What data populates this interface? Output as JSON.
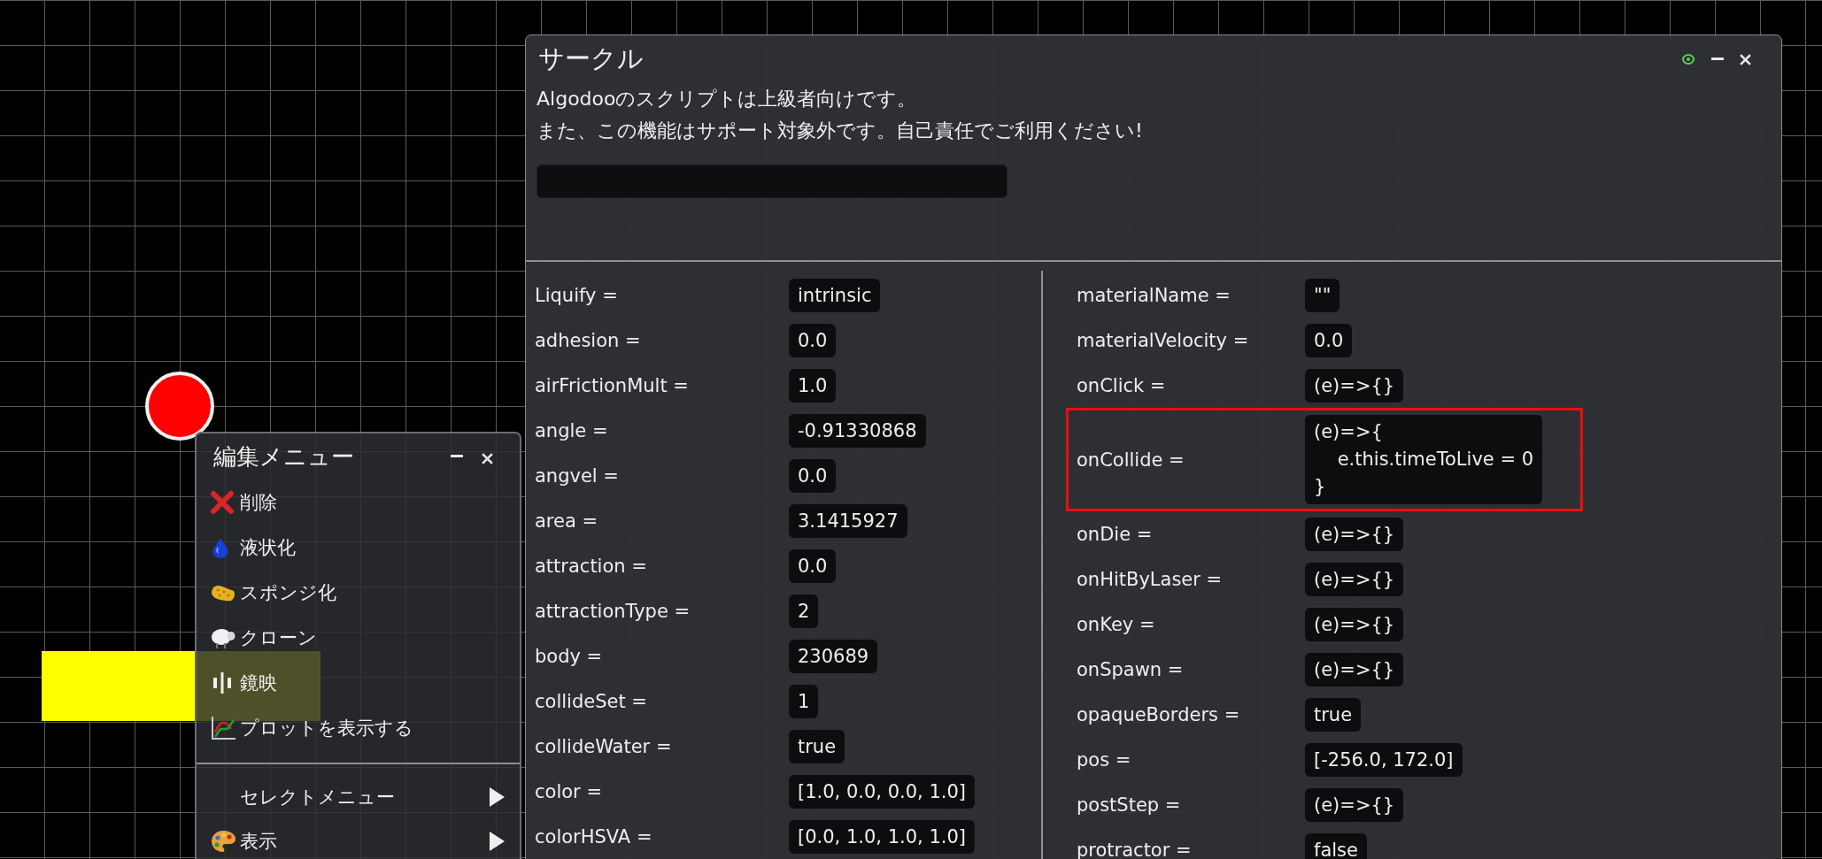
{
  "window": {
    "title": "サークル",
    "description": [
      "Algodooのスクリプトは上級者向けです。",
      "また、この機能はサポート対象外です。自己責任でご利用ください!"
    ],
    "properties": {
      "left": [
        {
          "label": "Liquify =",
          "value": "intrinsic",
          "highlighted": false
        },
        {
          "label": "adhesion =",
          "value": "0.0",
          "highlighted": false
        },
        {
          "label": "airFrictionMult =",
          "value": "1.0",
          "highlighted": false
        },
        {
          "label": "angle =",
          "value": "-0.91330868",
          "highlighted": false
        },
        {
          "label": "angvel =",
          "value": "0.0",
          "highlighted": false
        },
        {
          "label": "area =",
          "value": "3.1415927",
          "highlighted": false
        },
        {
          "label": "attraction =",
          "value": "0.0",
          "highlighted": false
        },
        {
          "label": "attractionType =",
          "value": "2",
          "highlighted": false
        },
        {
          "label": "body =",
          "value": "230689",
          "highlighted": false
        },
        {
          "label": "collideSet =",
          "value": "1",
          "highlighted": false
        },
        {
          "label": "collideWater =",
          "value": "true",
          "highlighted": false
        },
        {
          "label": "color =",
          "value": "[1.0, 0.0, 0.0, 1.0]",
          "highlighted": false
        },
        {
          "label": "colorHSVA =",
          "value": "[0.0, 1.0, 1.0, 1.0]",
          "highlighted": false
        }
      ],
      "right": [
        {
          "label": "materialName =",
          "value": "\"\"",
          "highlighted": false
        },
        {
          "label": "materialVelocity =",
          "value": "0.0",
          "highlighted": false
        },
        {
          "label": "onClick =",
          "value": "(e)=>{}",
          "highlighted": false
        },
        {
          "label": "onCollide =",
          "value": "(e)=>{\n    e.this.timeToLive = 0\n}",
          "highlighted": true
        },
        {
          "label": "onDie =",
          "value": "(e)=>{}",
          "highlighted": false
        },
        {
          "label": "onHitByLaser =",
          "value": "(e)=>{}",
          "highlighted": false
        },
        {
          "label": "onKey =",
          "value": "(e)=>{}",
          "highlighted": false
        },
        {
          "label": "onSpawn =",
          "value": "(e)=>{}",
          "highlighted": false
        },
        {
          "label": "opaqueBorders =",
          "value": "true",
          "highlighted": false
        },
        {
          "label": "pos =",
          "value": "[-256.0, 172.0]",
          "highlighted": false
        },
        {
          "label": "postStep =",
          "value": "(e)=>{}",
          "highlighted": false
        },
        {
          "label": "protractor =",
          "value": "false",
          "highlighted": false
        }
      ]
    }
  },
  "edit_menu": {
    "title": "編集メニュー",
    "items": [
      {
        "label": "削除"
      },
      {
        "label": "液状化"
      },
      {
        "label": "スポンジ化"
      },
      {
        "label": "クローン"
      },
      {
        "label": "鏡映"
      },
      {
        "label": "プロットを表示する"
      }
    ],
    "submenus": [
      {
        "label": "セレクトメニュー",
        "kind": "submenu"
      },
      {
        "label": "表示",
        "kind": "submenu"
      }
    ]
  }
}
